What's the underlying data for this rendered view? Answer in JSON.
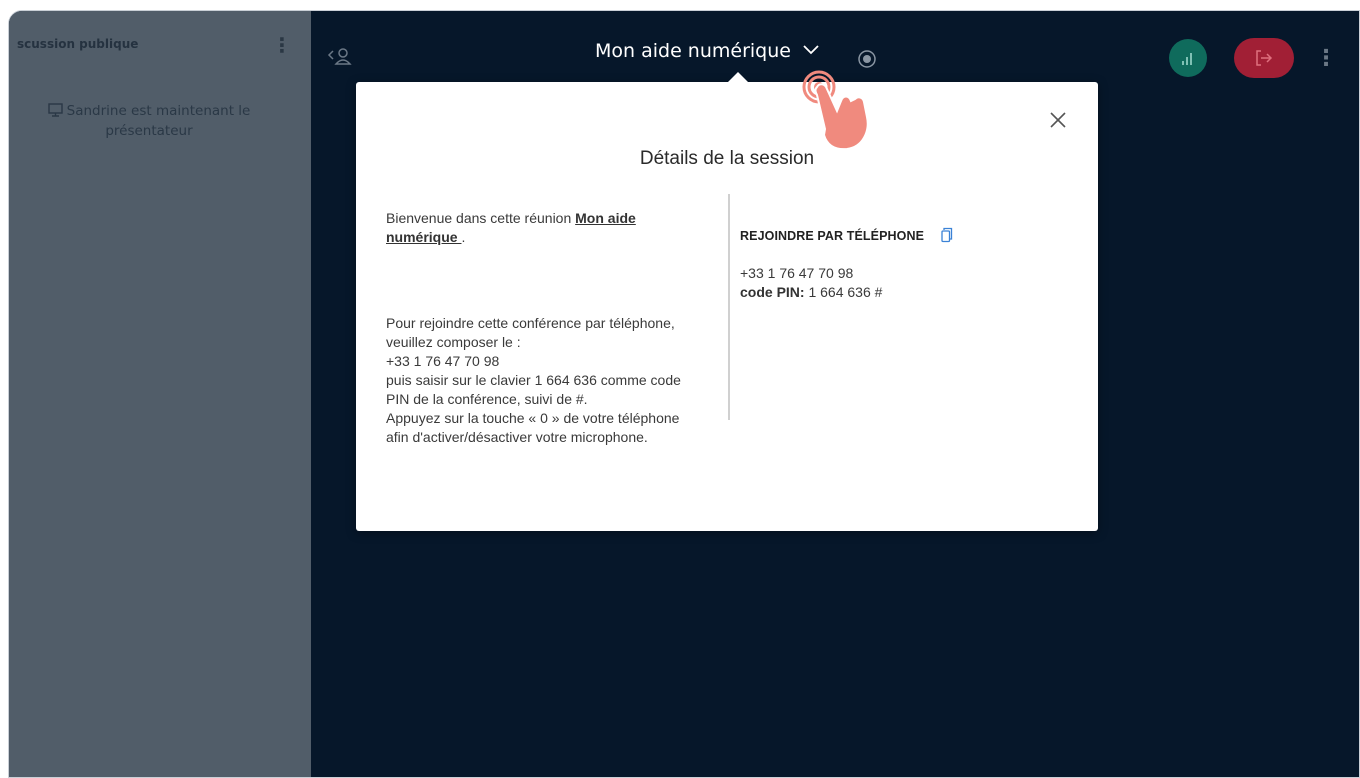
{
  "sidebar": {
    "title": "scussion publique",
    "presenter_message": "Sandrine est maintenant le présentateur"
  },
  "topbar": {
    "meeting_title": "Mon aide numérique",
    "icons": [
      "user-list-icon",
      "chevron-down-icon",
      "record-icon",
      "connection-status-icon",
      "leave-icon",
      "more-options-icon"
    ]
  },
  "modal": {
    "title": "Détails de la session",
    "welcome_prefix": "Bienvenue dans cette réunion ",
    "welcome_link": "Mon aide numérique ",
    "welcome_suffix": ".",
    "instructions_1": "Pour rejoindre cette conférence par téléphone, veuillez composer le :",
    "instructions_phone": "+33 1 76 47 70 98",
    "instructions_2": "puis saisir sur le clavier 1 664 636 comme code PIN de la conférence, suivi de #.",
    "instructions_3": "Appuyez sur la touche « 0 » de votre téléphone afin d'activer/désactiver votre microphone.",
    "phone_heading": "REJOINDRE PAR TÉLÉPHONE",
    "phone_number": "+33 1 76 47 70 98",
    "pin_label": "code PIN:",
    "pin_value": " 1 664 636 #"
  },
  "colors": {
    "background": "#06172a",
    "sidebar": "#515d69",
    "connection": "#0f6b5c",
    "leave": "#a11f35",
    "tap_hand": "#f08a7e"
  }
}
